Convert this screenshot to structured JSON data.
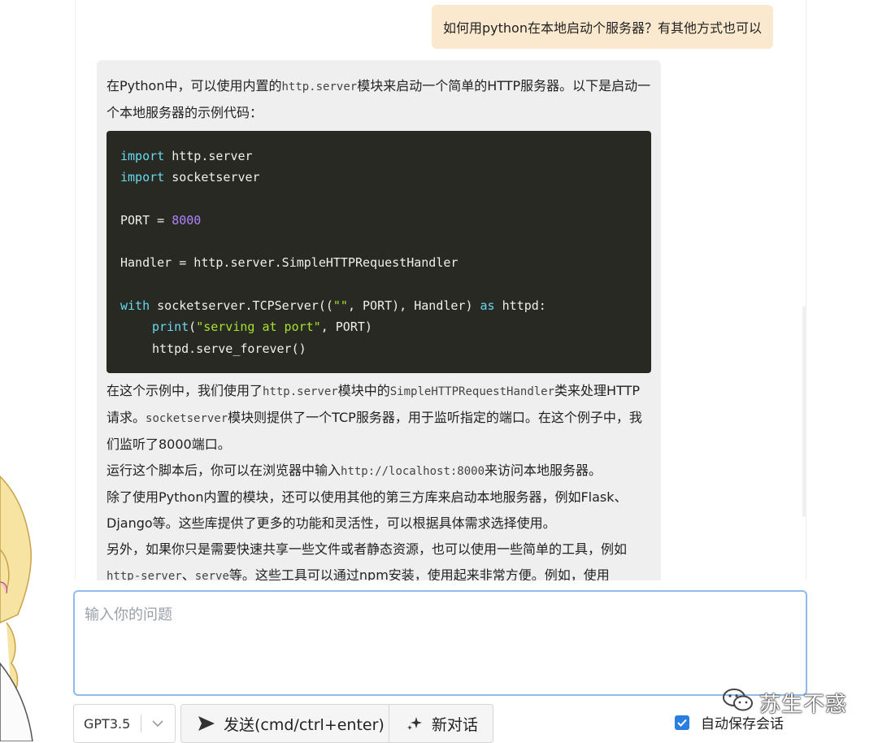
{
  "conversation": {
    "user_message": "如何用python在本地启动个服务器？有其他方式也可以",
    "assistant": {
      "intro_1": "在Python中，可以使用内置的",
      "intro_code": "http.server",
      "intro_2": "模块来启动一个简单的HTTP服务器。以下是启动一个本地服务器的示例代码：",
      "code": {
        "l1_kw": "import",
        "l1_rest": " http.server",
        "l2_kw": "import",
        "l2_rest": " socketserver",
        "l4_a": "PORT = ",
        "l4_num": "8000",
        "l6": "Handler = http.server.SimpleHTTPRequestHandler",
        "l8_kw": "with",
        "l8_a": " socketserver.TCPServer((",
        "l8_str": "\"\"",
        "l8_b": ", PORT), Handler) ",
        "l8_kw2": "as",
        "l8_c": " httpd:",
        "l9_kw": "print",
        "l9_a": "(",
        "l9_str": "\"serving at port\"",
        "l9_b": ", PORT)",
        "l10": "httpd.serve_forever()"
      },
      "p2_a": "在这个示例中，我们使用了",
      "p2_code1": "http.server",
      "p2_b": "模块中的",
      "p2_code2": "SimpleHTTPRequestHandler",
      "p2_c": "类来处理HTTP请求。",
      "p2_code3": "socketserver",
      "p2_d": "模块则提供了一个TCP服务器，用于监听指定的端口。在这个例子中，我们监听了8000端口。",
      "p3_a": "运行这个脚本后，你可以在浏览器中输入",
      "p3_code": "http://localhost:8000",
      "p3_b": "来访问本地服务器。",
      "p4": "除了使用Python内置的模块，还可以使用其他的第三方库来启动本地服务器，例如Flask、Django等。这些库提供了更多的功能和灵活性，可以根据具体需求选择使用。",
      "p5_a": "另外，如果你只是需要快速共享一些文件或者静态资源，也可以使用一些简单的工具，例如",
      "p5_code1": "http-server",
      "p5_b": "、",
      "p5_code2": "serve",
      "p5_c": "等。这些工具可以通过npm安装，使用起来非常方便。例如，使用"
    }
  },
  "input": {
    "placeholder": "输入你的问题"
  },
  "toolbar": {
    "model_value": "GPT3.5",
    "send_label": "发送(cmd/ctrl+enter)",
    "new_chat_label": "新对话",
    "autosave_label": "自动保存会话"
  },
  "watermark": {
    "text": "苏生不惑"
  },
  "colors": {
    "accent": "#2a7ee0",
    "user_bubble": "#fbe9cf",
    "code_bg": "#282923"
  },
  "icons": [
    "chevron-down-icon",
    "send-icon",
    "sparkle-icon",
    "check-icon",
    "wechat-icon"
  ]
}
